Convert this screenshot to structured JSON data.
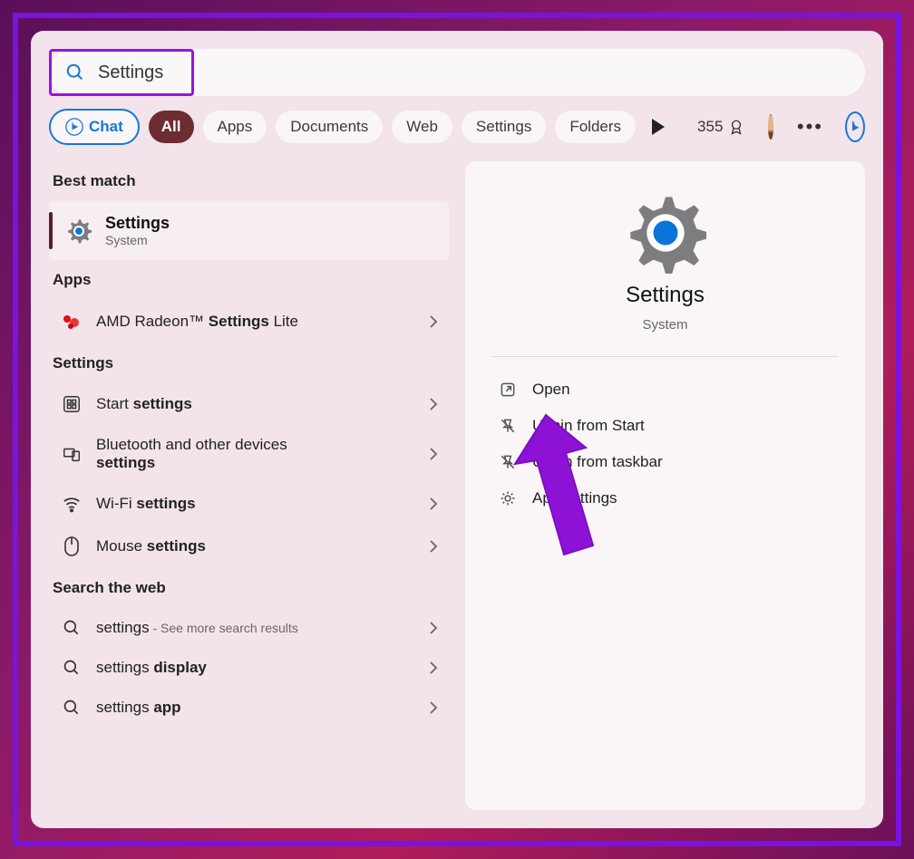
{
  "search": {
    "query": "Settings"
  },
  "filters": {
    "chat": "Chat",
    "all": "All",
    "apps": "Apps",
    "documents": "Documents",
    "web": "Web",
    "settings": "Settings",
    "folders": "Folders",
    "points": "355"
  },
  "left": {
    "best_match_header": "Best match",
    "best_match": {
      "title": "Settings",
      "subtitle": "System"
    },
    "apps_header": "Apps",
    "apps": [
      {
        "pre": "AMD Radeon™ ",
        "bold": "Settings",
        "post": " Lite",
        "icon": "amd"
      }
    ],
    "settings_header": "Settings",
    "settings": [
      {
        "pre": "Start ",
        "bold": "settings",
        "post": "",
        "icon": "start"
      },
      {
        "pre": "Bluetooth and other devices ",
        "bold": "settings",
        "post": "",
        "icon": "bt",
        "multiline": true
      },
      {
        "pre": "Wi-Fi ",
        "bold": "settings",
        "post": "",
        "icon": "wifi"
      },
      {
        "pre": "Mouse ",
        "bold": "settings",
        "post": "",
        "icon": "mouse"
      }
    ],
    "web_header": "Search the web",
    "web": [
      {
        "term": "settings",
        "hint": " - See more search results"
      },
      {
        "term": "settings ",
        "bold": "display"
      },
      {
        "term": "settings ",
        "bold": "app"
      }
    ]
  },
  "right": {
    "title": "Settings",
    "subtitle": "System",
    "actions": [
      {
        "label_pre": "Open",
        "label_mid": "",
        "label_post": "",
        "icon": "open"
      },
      {
        "label_pre": "Unpin",
        "label_mid": " from ",
        "label_post": "Start",
        "icon": "unpin"
      },
      {
        "label_pre": "Unpin",
        "label_mid": " from ",
        "label_post": "taskbar",
        "icon": "unpin"
      },
      {
        "label_pre": "App settings",
        "label_mid": "",
        "label_post": "",
        "icon": "gear"
      }
    ]
  }
}
